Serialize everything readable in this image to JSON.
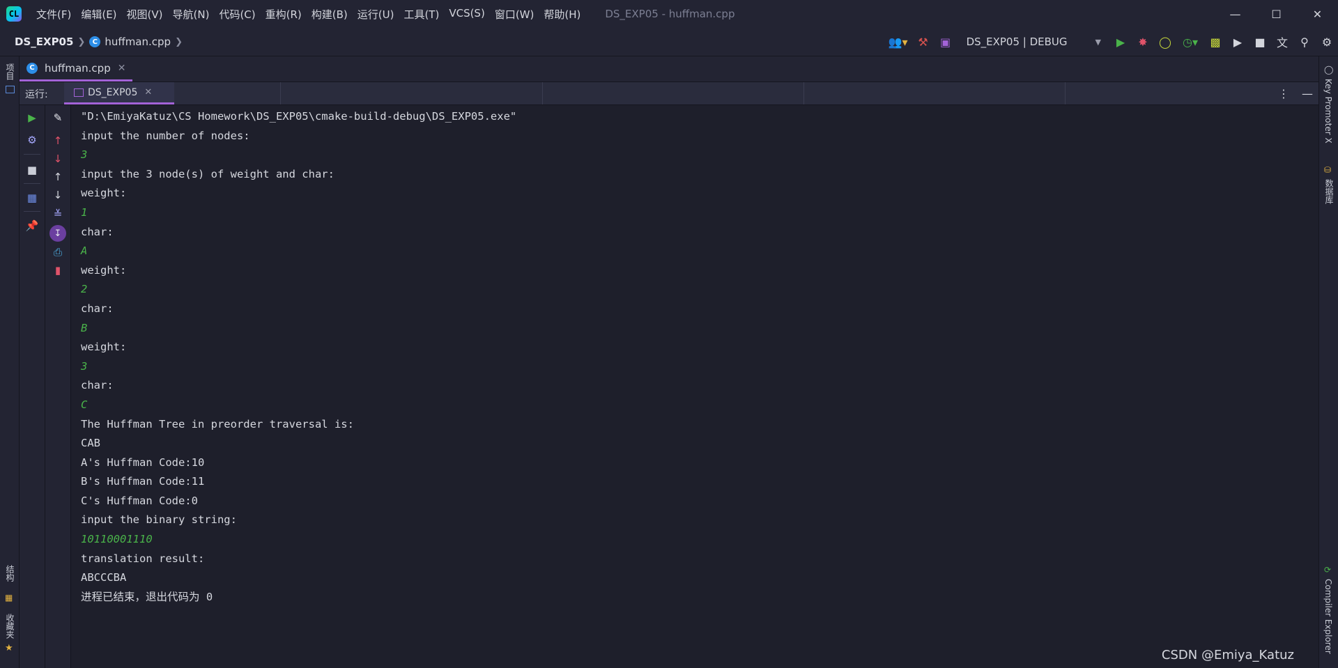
{
  "menu": [
    "文件(F)",
    "编辑(E)",
    "视图(V)",
    "导航(N)",
    "代码(C)",
    "重构(R)",
    "构建(B)",
    "运行(U)",
    "工具(T)",
    "VCS(S)",
    "窗口(W)",
    "帮助(H)"
  ],
  "window": {
    "title": "DS_EXP05 - huffman.cpp"
  },
  "breadcrumb": {
    "project": "DS_EXP05",
    "file": "huffman.cpp"
  },
  "toolbar": {
    "run_config": "DS_EXP05 | DEBUG"
  },
  "editor": {
    "tab_label": "huffman.cpp"
  },
  "run_panel": {
    "label": "运行:",
    "tab_label": "DS_EXP05"
  },
  "left_stripe": {
    "project": "项目",
    "structure": "结构",
    "favorites": "收藏夹"
  },
  "right_stripe": {
    "key_promoter": "Key Promoter X",
    "database": "数据库",
    "compiler_explorer": "Compiler Explorer"
  },
  "console": {
    "lines": [
      {
        "text": "\"D:\\EmiyaKatuz\\CS Homework\\DS_EXP05\\cmake-build-debug\\DS_EXP05.exe\"",
        "type": "out"
      },
      {
        "text": "input the number of nodes:",
        "type": "out"
      },
      {
        "text": "3",
        "type": "in"
      },
      {
        "text": "input the 3 node(s) of weight and char:",
        "type": "out"
      },
      {
        "text": "weight:",
        "type": "out"
      },
      {
        "text": "1",
        "type": "in"
      },
      {
        "text": "char:",
        "type": "out"
      },
      {
        "text": "A",
        "type": "in"
      },
      {
        "text": "weight:",
        "type": "out"
      },
      {
        "text": "2",
        "type": "in"
      },
      {
        "text": "char:",
        "type": "out"
      },
      {
        "text": "B",
        "type": "in"
      },
      {
        "text": "weight:",
        "type": "out"
      },
      {
        "text": "3",
        "type": "in"
      },
      {
        "text": "char:",
        "type": "out"
      },
      {
        "text": "C",
        "type": "in"
      },
      {
        "text": "The Huffman Tree in preorder traversal is:",
        "type": "out"
      },
      {
        "text": "CAB",
        "type": "out"
      },
      {
        "text": "A's Huffman Code:10",
        "type": "out"
      },
      {
        "text": "B's Huffman Code:11",
        "type": "out"
      },
      {
        "text": "C's Huffman Code:0",
        "type": "out"
      },
      {
        "text": "input the binary string:",
        "type": "out"
      },
      {
        "text": "10110001110",
        "type": "in"
      },
      {
        "text": "translation result:",
        "type": "out"
      },
      {
        "text": "ABCCCBA",
        "type": "out"
      },
      {
        "text": "进程已结束，退出代码为 0",
        "type": "out"
      }
    ]
  },
  "watermark": "CSDN @Emiya_Katuz",
  "colors": {
    "accent": "#a363d8",
    "run_green": "#4ab34a",
    "background": "#1e1f2b"
  }
}
